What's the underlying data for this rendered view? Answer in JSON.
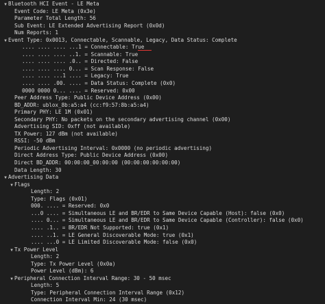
{
  "icons": {
    "expanded": "triangle-down",
    "collapsed": "triangle-right"
  },
  "colors": {
    "background": "#1e1e1e",
    "text": "#d4d4d4",
    "annotation": "#e53935"
  },
  "rows": [
    {
      "indent": 0,
      "expander": "expanded",
      "text": "Bluetooth HCI Event - LE Meta"
    },
    {
      "indent": 1,
      "expander": "none",
      "text": "Event Code: LE Meta (0x3e)"
    },
    {
      "indent": 1,
      "expander": "none",
      "text": "Parameter Total Length: 56"
    },
    {
      "indent": 1,
      "expander": "none",
      "text": "Sub Event: LE Extended Advertising Report (0x0d)"
    },
    {
      "indent": 1,
      "expander": "none",
      "text": "Num Reports: 1"
    },
    {
      "indent": 0,
      "expander": "expanded",
      "text": "Event Type: 0x0013, Connectable, Scannable, Legacy, Data Status: Complete"
    },
    {
      "indent": 2,
      "expander": "none",
      "text": ".... .... .... ...1 = Connectable: True"
    },
    {
      "indent": 2,
      "expander": "none",
      "text": ".... .... .... ..1. = Scannable: True"
    },
    {
      "indent": 2,
      "expander": "none",
      "text": ".... .... .... .0.. = Directed: False"
    },
    {
      "indent": 2,
      "expander": "none",
      "text": ".... .... .... 0... = Scan Response: False"
    },
    {
      "indent": 2,
      "expander": "none",
      "text": ".... .... ...1 .... = Legacy: True"
    },
    {
      "indent": 2,
      "expander": "none",
      "text": ".... .... .00. .... = Data Status: Complete (0x0)"
    },
    {
      "indent": 2,
      "expander": "none",
      "text": "0000 0000 0... .... = Reserved: 0x00"
    },
    {
      "indent": 1,
      "expander": "none",
      "text": "Peer Address Type: Public Device Address (0x00)"
    },
    {
      "indent": 1,
      "expander": "none",
      "text": "BD_ADDR: ublox_8b:a5:a4 (cc:f9:57:8b:a5:a4)"
    },
    {
      "indent": 1,
      "expander": "none",
      "text": "Primary PHY: LE 1M (0x01)"
    },
    {
      "indent": 1,
      "expander": "none",
      "text": "Secondary PHY: No packets on the secondary advertising channel (0x00)"
    },
    {
      "indent": 1,
      "expander": "none",
      "text": "Advertising SID: 0xff (not available)"
    },
    {
      "indent": 1,
      "expander": "none",
      "text": "TX Power: 127 dBm (not available)"
    },
    {
      "indent": 1,
      "expander": "none",
      "text": "RSSI: -50 dBm"
    },
    {
      "indent": 1,
      "expander": "none",
      "text": "Periodic Advertising Interval: 0x0000 (no periodic advertising)"
    },
    {
      "indent": 1,
      "expander": "none",
      "text": "Direct Address Type: Public Device Address (0x00)"
    },
    {
      "indent": 1,
      "expander": "none",
      "text": "Direct BD_ADDR: 00:00:00_00:00:00 (00:00:00:00:00:00)"
    },
    {
      "indent": 1,
      "expander": "none",
      "text": "Data Length: 30"
    },
    {
      "indent": 0,
      "expander": "expanded",
      "text": "Advertising Data"
    },
    {
      "indent": 1,
      "expander": "expanded",
      "text": "Flags"
    },
    {
      "indent": 3,
      "expander": "none",
      "text": "Length: 2"
    },
    {
      "indent": 3,
      "expander": "none",
      "text": "Type: Flags (0x01)"
    },
    {
      "indent": 3,
      "expander": "none",
      "text": "000. .... = Reserved: 0x0"
    },
    {
      "indent": 3,
      "expander": "none",
      "text": "...0 .... = Simultaneous LE and BR/EDR to Same Device Capable (Host): false (0x0)"
    },
    {
      "indent": 3,
      "expander": "none",
      "text": ".... 0... = Simultaneous LE and BR/EDR to Same Device Capable (Controller): false (0x0)"
    },
    {
      "indent": 3,
      "expander": "none",
      "text": ".... .1.. = BR/EDR Not Supported: true (0x1)"
    },
    {
      "indent": 3,
      "expander": "none",
      "text": ".... ..1. = LE General Discoverable Mode: true (0x1)"
    },
    {
      "indent": 3,
      "expander": "none",
      "text": ".... ...0 = LE Limited Discoverable Mode: false (0x0)"
    },
    {
      "indent": 1,
      "expander": "expanded",
      "text": "Tx Power Level"
    },
    {
      "indent": 3,
      "expander": "none",
      "text": "Length: 2"
    },
    {
      "indent": 3,
      "expander": "none",
      "text": "Type: Tx Power Level (0x0a)"
    },
    {
      "indent": 3,
      "expander": "none",
      "text": "Power Level (dBm): 6"
    },
    {
      "indent": 1,
      "expander": "expanded",
      "text": "Peripheral Connection Interval Range: 30 - 50 msec"
    },
    {
      "indent": 3,
      "expander": "none",
      "text": "Length: 5"
    },
    {
      "indent": 3,
      "expander": "none",
      "text": "Type: Peripheral Connection Interval Range (0x12)"
    },
    {
      "indent": 3,
      "expander": "none",
      "text": "Connection Interval Min: 24 (30 msec)"
    }
  ]
}
